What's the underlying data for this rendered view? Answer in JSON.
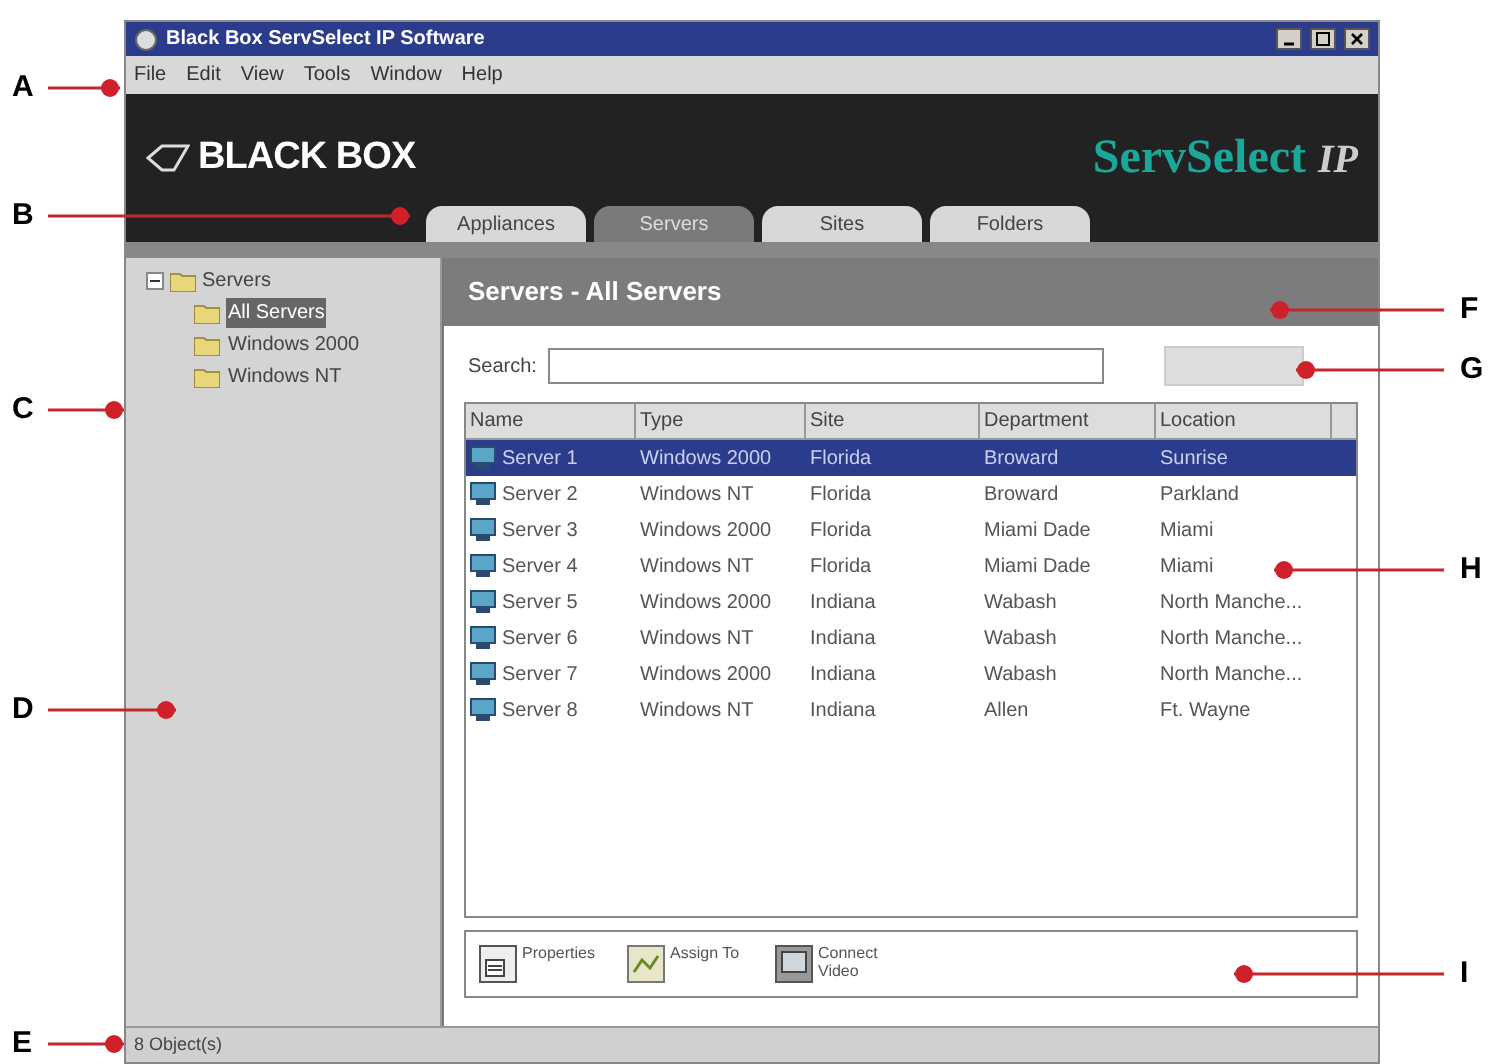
{
  "window": {
    "title": "Black Box ServSelect IP Software"
  },
  "menu": [
    "File",
    "Edit",
    "View",
    "Tools",
    "Window",
    "Help"
  ],
  "banner": {
    "logo": "BLACK BOX",
    "product": "ServSelect",
    "product_suffix": "IP"
  },
  "tabs": [
    {
      "label": "Appliances",
      "selected": false
    },
    {
      "label": "Servers",
      "selected": true
    },
    {
      "label": "Sites",
      "selected": false
    },
    {
      "label": "Folders",
      "selected": false
    }
  ],
  "tree": {
    "label": "Servers",
    "expanded": true,
    "children": [
      {
        "label": "All Servers",
        "selected": true
      },
      {
        "label": "Windows 2000",
        "selected": false
      },
      {
        "label": "Windows NT",
        "selected": false
      }
    ]
  },
  "panel": {
    "title": "Servers - All Servers",
    "search_label": "Search:"
  },
  "table": {
    "columns": [
      "Name",
      "Type",
      "Site",
      "Department",
      "Location"
    ],
    "rows": [
      {
        "cells": [
          "Server 1",
          "Windows 2000",
          "Florida",
          "Broward",
          "Sunrise"
        ],
        "selected": true
      },
      {
        "cells": [
          "Server 2",
          "Windows NT",
          "Florida",
          "Broward",
          "Parkland"
        ],
        "selected": false
      },
      {
        "cells": [
          "Server 3",
          "Windows 2000",
          "Florida",
          "Miami Dade",
          "Miami"
        ],
        "selected": false
      },
      {
        "cells": [
          "Server 4",
          "Windows NT",
          "Florida",
          "Miami Dade",
          "Miami"
        ],
        "selected": false
      },
      {
        "cells": [
          "Server 5",
          "Windows 2000",
          "Indiana",
          "Wabash",
          "North Manche..."
        ],
        "selected": false
      },
      {
        "cells": [
          "Server 6",
          "Windows NT",
          "Indiana",
          "Wabash",
          "North Manche..."
        ],
        "selected": false
      },
      {
        "cells": [
          "Server 7",
          "Windows 2000",
          "Indiana",
          "Wabash",
          "North Manche..."
        ],
        "selected": false
      },
      {
        "cells": [
          "Server 8",
          "Windows NT",
          "Indiana",
          "Allen",
          "Ft. Wayne"
        ],
        "selected": false
      }
    ]
  },
  "toolbar": [
    {
      "label": "Properties"
    },
    {
      "label": "Assign To"
    },
    {
      "label": "Connect Video"
    }
  ],
  "status_bar": "8 Object(s)",
  "callouts": [
    "A",
    "B",
    "C",
    "D",
    "E",
    "F",
    "G",
    "H",
    "I"
  ]
}
